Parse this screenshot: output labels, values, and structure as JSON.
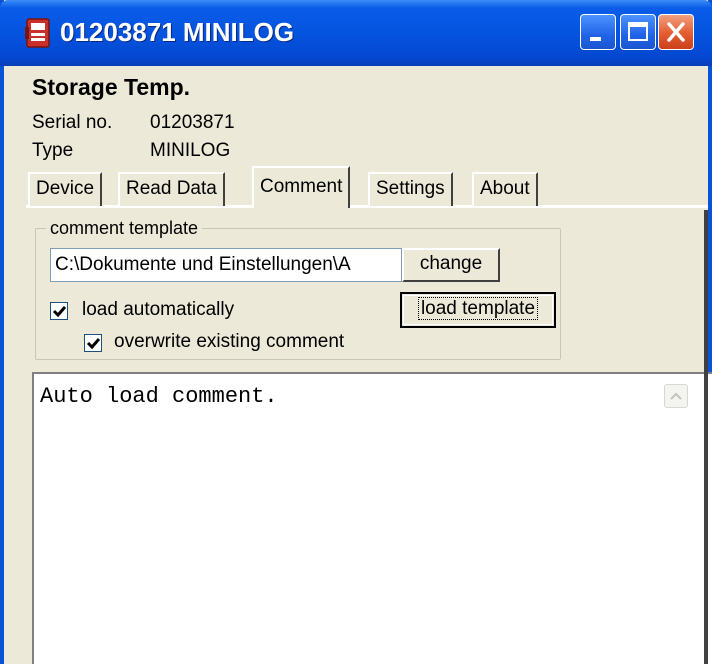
{
  "window": {
    "title": "01203871 MINILOG",
    "icon": "minilog-app-icon"
  },
  "header": {
    "title": "Storage Temp.",
    "serial_label": "Serial no.",
    "serial_value": "01203871",
    "type_label": "Type",
    "type_value": "MINILOG"
  },
  "tabs": [
    {
      "label": "Device",
      "active": false
    },
    {
      "label": "Read Data",
      "active": false
    },
    {
      "label": "Comment",
      "active": true
    },
    {
      "label": "Settings",
      "active": false
    },
    {
      "label": "About",
      "active": false
    }
  ],
  "comment_template": {
    "group_label": "comment template",
    "path_value": "C:\\Dokumente und Einstellungen\\A",
    "change_label": "change",
    "load_template_label": "load template",
    "load_automatically": {
      "label": "load automatically",
      "checked": true
    },
    "overwrite_existing": {
      "label": "overwrite existing comment",
      "checked": true
    }
  },
  "comment": {
    "text": "Auto load comment."
  },
  "colors": {
    "titlebar": "#0554e0",
    "window_bg": "#ece9d8",
    "close_button": "#e35b2e"
  }
}
